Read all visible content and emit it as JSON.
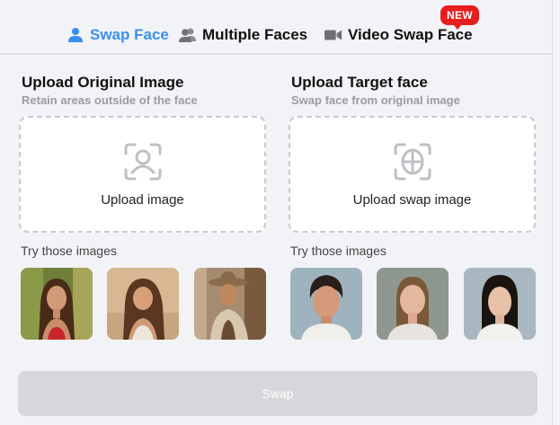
{
  "tabs": {
    "swap_face": "Swap Face",
    "multiple_faces": "Multiple Faces",
    "video_swap_face": "Video Swap Face",
    "new_badge": "NEW"
  },
  "original": {
    "title": "Upload Original Image",
    "subtitle": "Retain areas outside of the face",
    "upload_label": "Upload image",
    "try_label": "Try those images"
  },
  "target": {
    "title": "Upload Target face",
    "subtitle": "Swap face from original image",
    "upload_label": "Upload swap image",
    "try_label": "Try those images"
  },
  "swap_button": "Swap",
  "colors": {
    "accent": "#3b8ff0",
    "badge": "#e61e1e",
    "disabled_button": "#d6d7da",
    "background": "#f2f3f7"
  },
  "icons": {
    "swap_face_tab": "person-icon",
    "multiple_faces_tab": "people-icon",
    "video_swap_tab": "video-camera-icon",
    "upload_original": "face-scan-icon",
    "upload_target": "face-outline-scan-icon"
  }
}
